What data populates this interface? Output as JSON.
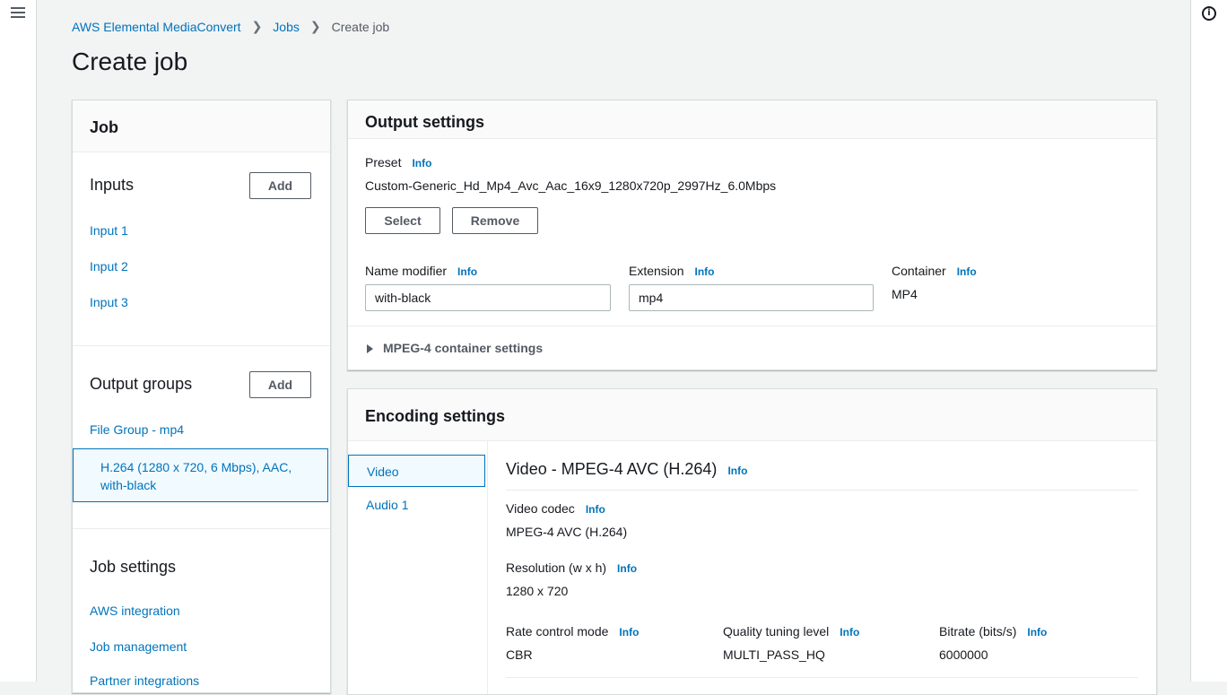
{
  "breadcrumb": [
    "AWS Elemental MediaConvert",
    "Jobs",
    "Create job"
  ],
  "page_title": "Create job",
  "job_panel": {
    "title": "Job",
    "inputs_title": "Inputs",
    "add_label": "Add",
    "inputs": [
      "Input 1",
      "Input 2",
      "Input 3"
    ],
    "output_groups_title": "Output groups",
    "output_group": "File Group - mp4",
    "output_selected": "H.264 (1280 x 720, 6 Mbps), AAC, with-black",
    "job_settings_title": "Job settings",
    "job_settings_links": [
      "AWS integration",
      "Job management",
      "Partner integrations"
    ]
  },
  "output_settings": {
    "title": "Output settings",
    "preset_label": "Preset",
    "info": "Info",
    "preset_value": "Custom-Generic_Hd_Mp4_Avc_Aac_16x9_1280x720p_2997Hz_6.0Mbps",
    "select_label": "Select",
    "remove_label": "Remove",
    "name_modifier_label": "Name modifier",
    "name_modifier_value": "with-black",
    "extension_label": "Extension",
    "extension_value": "mp4",
    "container_label": "Container",
    "container_value": "MP4",
    "mpeg4_settings": "MPEG-4 container settings"
  },
  "encoding_settings": {
    "title": "Encoding settings",
    "tabs": [
      "Video",
      "Audio 1"
    ],
    "video_title": "Video - MPEG-4 AVC (H.264)",
    "video_codec_label": "Video codec",
    "video_codec_value": "MPEG-4 AVC (H.264)",
    "resolution_label": "Resolution (w x h)",
    "resolution_value": "1280 x 720",
    "rate_control_label": "Rate control mode",
    "rate_control_value": "CBR",
    "quality_label": "Quality tuning level",
    "quality_value": "MULTI_PASS_HQ",
    "bitrate_label": "Bitrate (bits/s)",
    "bitrate_value": "6000000"
  }
}
